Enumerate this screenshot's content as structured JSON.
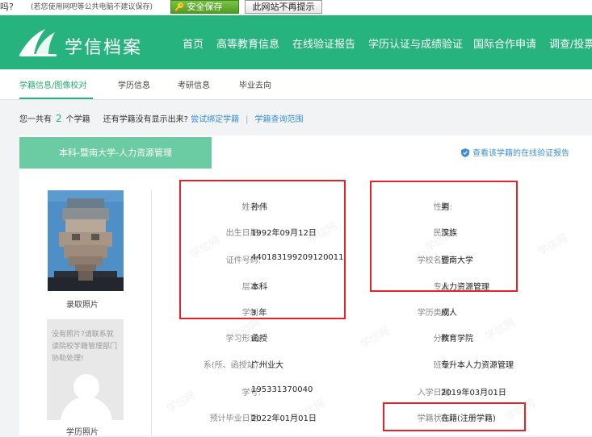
{
  "notice": {
    "question_tail": "吗?",
    "hint": "(若您使用网吧等公共电脑不建议保存)",
    "save_button": "安全保存",
    "no_more_button": "此网站不再提示"
  },
  "header": {
    "logo_text": "学信档案",
    "nav": [
      "首页",
      "高等教育信息",
      "在线验证报告",
      "学历认证与成绩验证",
      "国际合作申请",
      "调查/投票"
    ]
  },
  "subnav": {
    "items": [
      "学籍信息/图像校对",
      "学历信息",
      "考研信息",
      "毕业去向"
    ],
    "active_index": 0
  },
  "info_line": {
    "prefix": "您一共有",
    "count": "2",
    "suffix": "个学籍",
    "question": "还有学籍没有显示出来?",
    "link_bind": "尝试绑定学籍",
    "separator": "|",
    "link_scope": "学籍查询范围"
  },
  "card": {
    "tab_title": "本科-暨南大学-人力资源管理",
    "verify_link": "查看该学籍的在线验证报告",
    "photo_label": "录取照片",
    "placeholder_text": "没有照片?请联系就读院校学籍管理部门协助处理!",
    "placeholder_label": "学历照片",
    "left_fields": [
      {
        "label": "姓名:",
        "value": "孙伟"
      },
      {
        "label": "出生日期:",
        "value": "1992年09月12日"
      },
      {
        "label": "证件号码:",
        "value": "440183199209120011"
      },
      {
        "label": "层次:",
        "value": "本科"
      },
      {
        "label": "学制:",
        "value": "3 年"
      },
      {
        "label": "学习形式:",
        "value": "函授"
      },
      {
        "label": "系(所、函授站):",
        "value": "广州业大"
      },
      {
        "label": "学号:",
        "value": "195331370040"
      },
      {
        "label": "预计毕业日期:",
        "value": "2022年01月01日"
      }
    ],
    "right_fields": [
      {
        "label": "性别:",
        "value": "男"
      },
      {
        "label": "民族:",
        "value": "汉族"
      },
      {
        "label": "学校名称:",
        "value": "暨南大学"
      },
      {
        "label": "专业:",
        "value": "人力资源管理"
      },
      {
        "label": "学历类别:",
        "value": "成人"
      },
      {
        "label": "分院:",
        "value": "教育学院"
      },
      {
        "label": "班级:",
        "value": "专升本人力资源管理"
      },
      {
        "label": "入学日期:",
        "value": "2019年03月01日"
      },
      {
        "label": "学籍状态:",
        "value": "在籍(注册学籍)"
      }
    ],
    "watermark": "学信网"
  },
  "colors": {
    "brand_green": "#27b37d",
    "tab_green": "#6bcba2",
    "link_blue": "#3a8fd6",
    "highlight_red": "#e8202a"
  }
}
